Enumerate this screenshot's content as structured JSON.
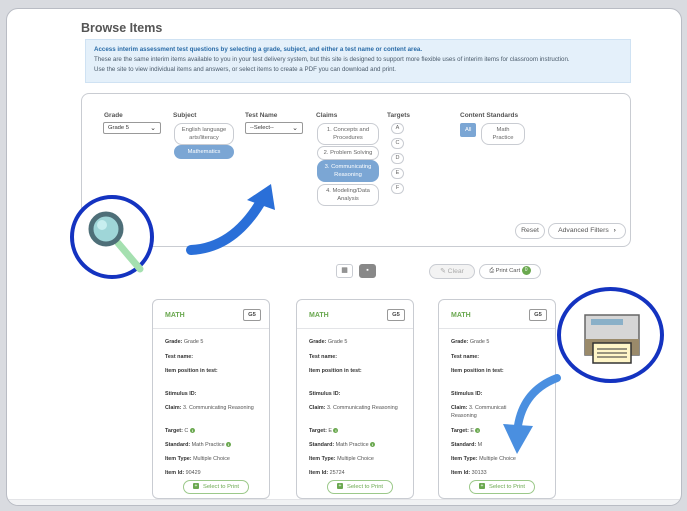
{
  "page": {
    "title": "Browse Items"
  },
  "info": {
    "headline": "Access interim assessment test questions by selecting a grade, subject, and either a test name or content area.",
    "line2": "These are the same interim items available to you in your test delivery system, but this site is designed to support more flexible uses of interim items for classroom instruction.",
    "line3": "Use the site to view individual items and answers, or select items to create a PDF you can download and print."
  },
  "filters": {
    "grade_label": "Grade",
    "grade_value": "Grade 5",
    "subject_label": "Subject",
    "subjects": [
      "English language arts/literacy",
      "Mathematics"
    ],
    "test_name_label": "Test Name",
    "test_name_value": "--Select--",
    "claims_label": "Claims",
    "claims": [
      "1. Concepts and Procedures",
      "2. Problem Solving",
      "3. Communicating Reasoning",
      "4. Modeling/Data Analysis"
    ],
    "targets_label": "Targets",
    "targets": [
      "A",
      "C",
      "D",
      "E",
      "F"
    ],
    "standards_label": "Content Standards",
    "standards_all": "All",
    "standards_math": "Math Practice",
    "reset": "Reset",
    "advanced": "Advanced Filters"
  },
  "toolbar": {
    "clear": "Clear",
    "print_cart": "Print Cart",
    "cart_count": "0"
  },
  "cards": [
    {
      "subject": "MATH",
      "grade_badge": "G5",
      "grade_label": "Grade:",
      "grade": "Grade 5",
      "test_name_label": "Test name:",
      "position_label": "Item position in test:",
      "stimulus_label": "Stimulus ID:",
      "claim_label": "Claim:",
      "claim": "3. Communicating Reasoning",
      "target_label": "Target:",
      "target": "C",
      "standard_label": "Standard:",
      "standard": "Math Practice",
      "type_label": "Item Type:",
      "type": "Multiple Choice",
      "id_label": "Item Id:",
      "id": "90429",
      "select": "Select to Print"
    },
    {
      "subject": "MATH",
      "grade_badge": "G5",
      "grade_label": "Grade:",
      "grade": "Grade 5",
      "test_name_label": "Test name:",
      "position_label": "Item position in test:",
      "stimulus_label": "Stimulus ID:",
      "claim_label": "Claim:",
      "claim": "3. Communicating Reasoning",
      "target_label": "Target:",
      "target": "E",
      "standard_label": "Standard:",
      "standard": "Math Practice",
      "type_label": "Item Type:",
      "type": "Multiple Choice",
      "id_label": "Item Id:",
      "id": "25724",
      "select": "Select to Print"
    },
    {
      "subject": "MATH",
      "grade_badge": "G5",
      "grade_label": "Grade:",
      "grade": "Grade 5",
      "test_name_label": "Test name:",
      "position_label": "Item position in test:",
      "stimulus_label": "Stimulus ID:",
      "claim_label": "Claim:",
      "claim": "3. Communicati",
      "target_label": "Target:",
      "target": "E",
      "standard_label": "Standard:",
      "standard": "M",
      "type_label": "Item Type:",
      "type": "Multiple Choice",
      "id_label": "Item Id:",
      "id": "30133",
      "select": "Select to Print"
    }
  ],
  "claim_extra_card3": "Reasoning",
  "colors": {
    "accent": "#7ba6d4",
    "math_green": "#6aa84f",
    "annotation_blue": "#1433c0"
  },
  "icons": [
    "chevron-down-icon",
    "list-view-icon",
    "grid-view-icon",
    "eraser-icon",
    "printer-icon",
    "chevron-right-icon",
    "info-icon",
    "plus-icon",
    "magnifier-icon"
  ]
}
